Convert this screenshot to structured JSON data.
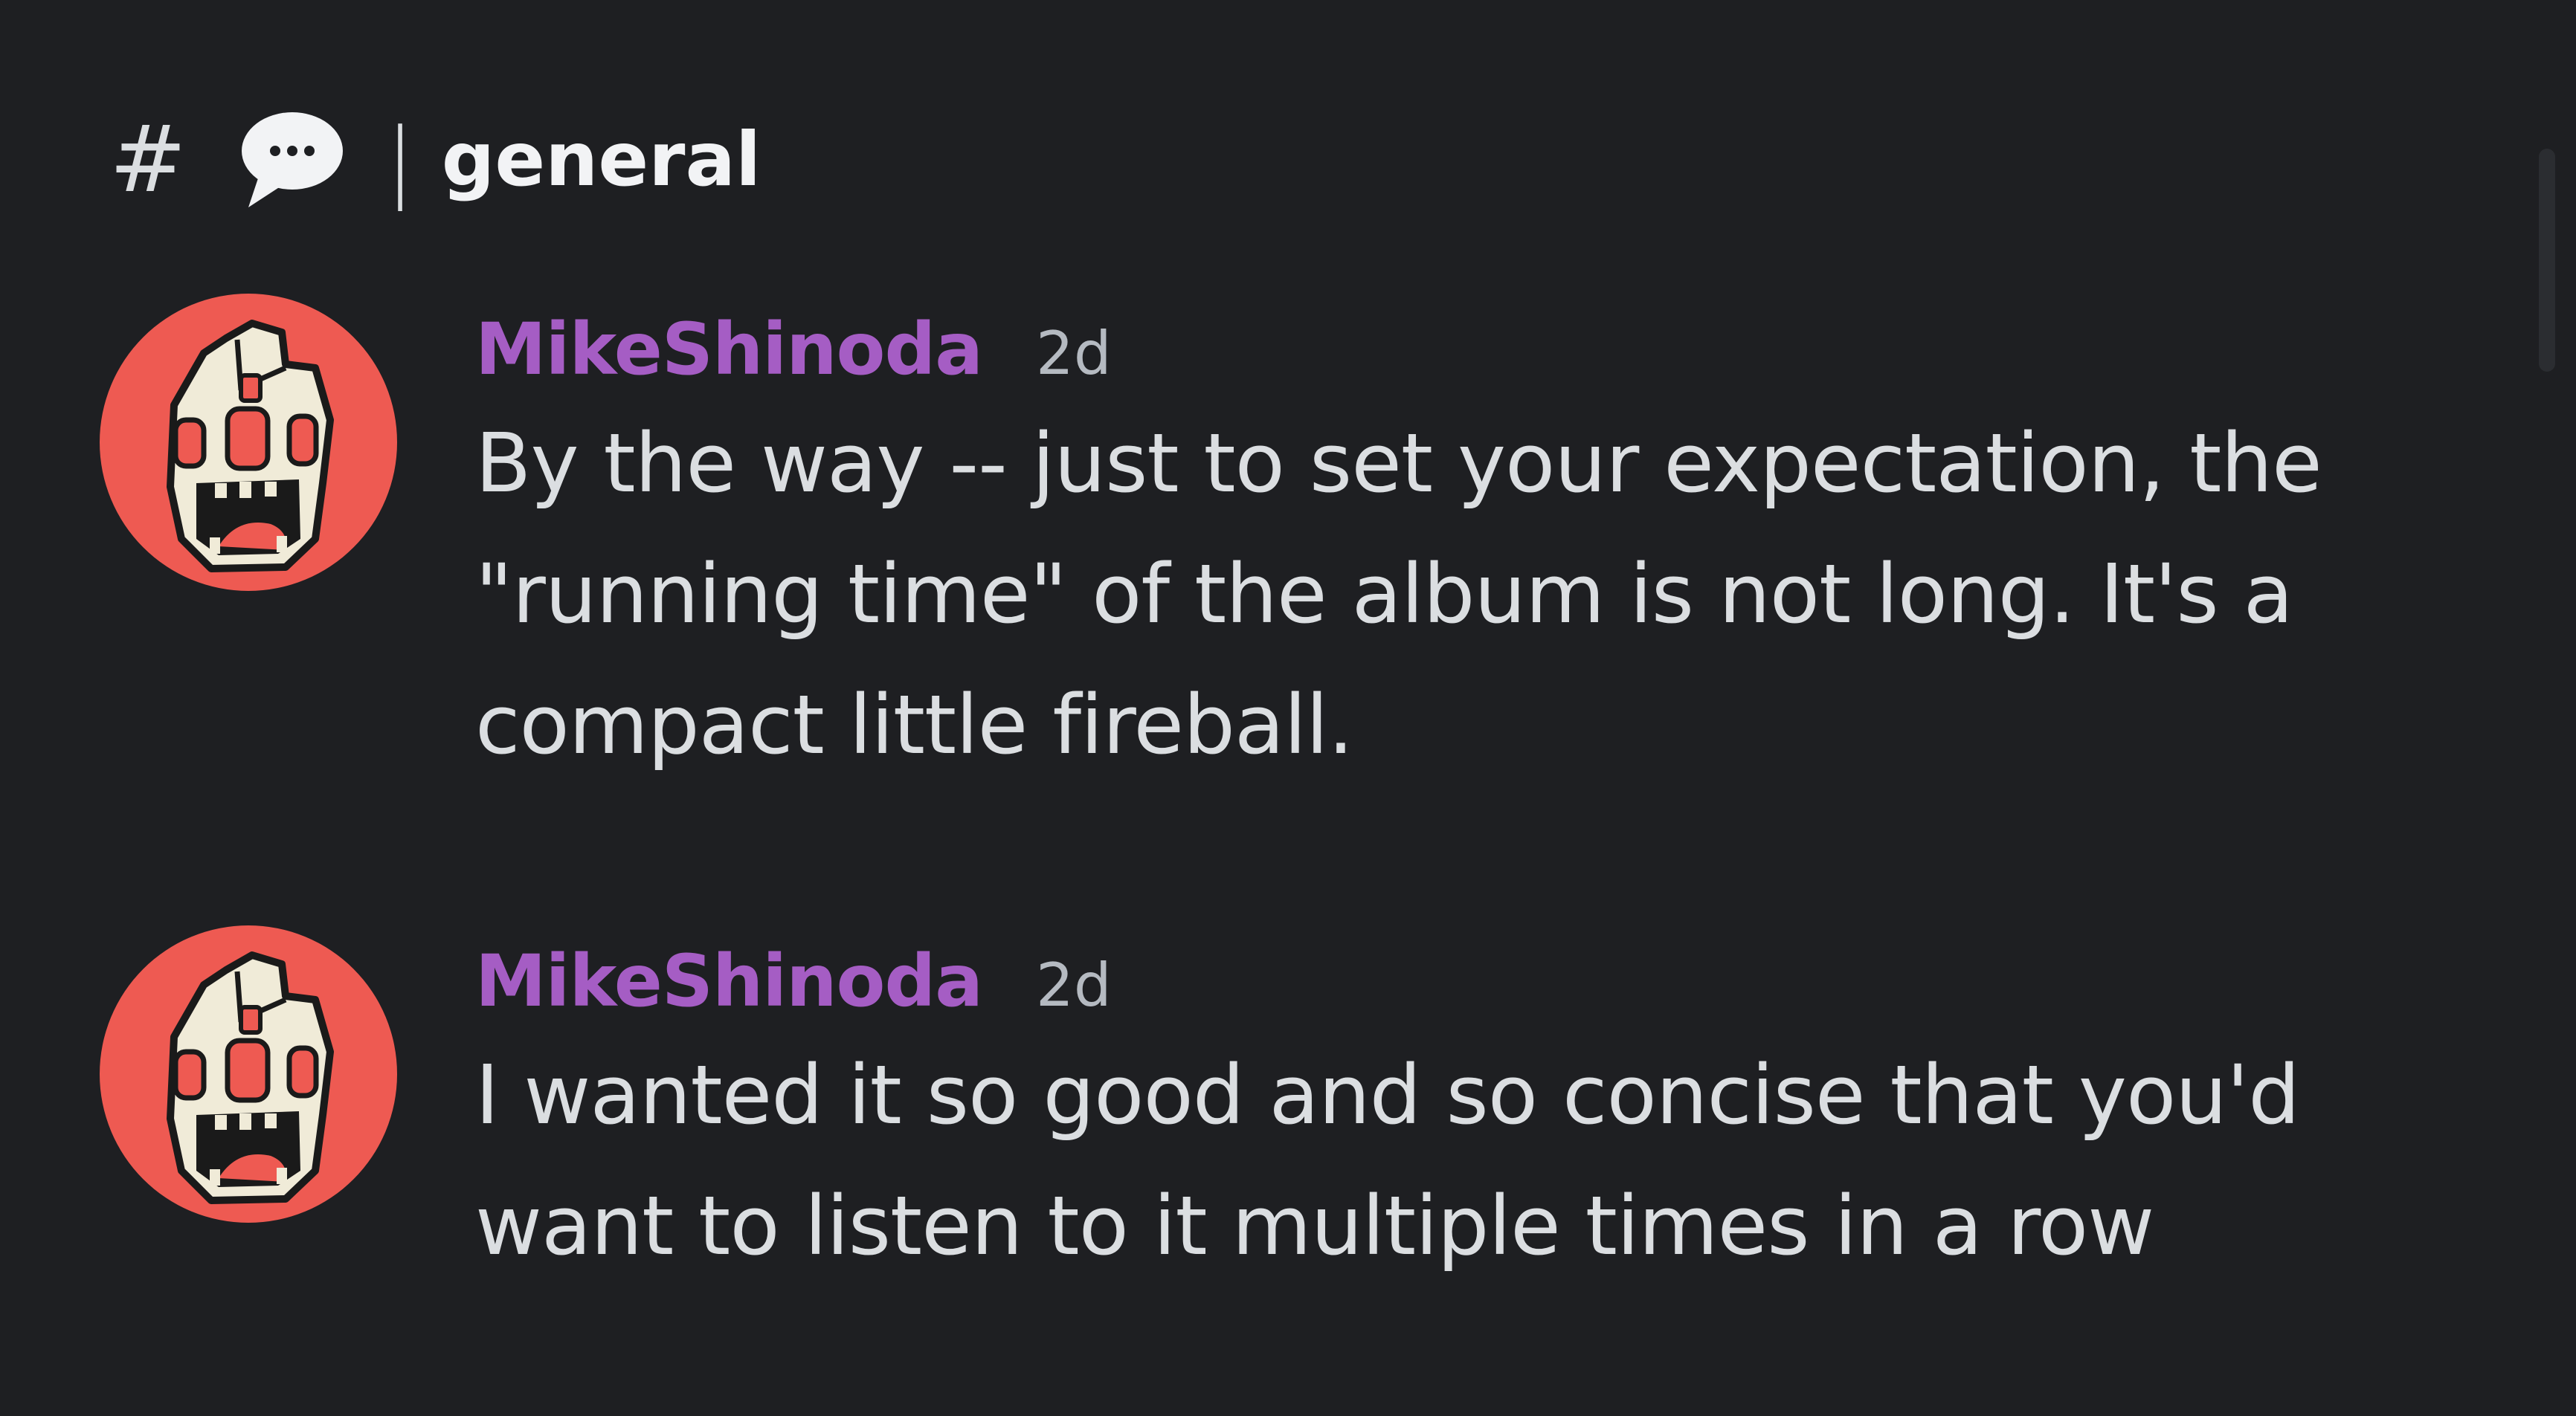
{
  "channel": {
    "hash_symbol": "#",
    "emoji_icon": "speech-bubble-icon",
    "separator": "|",
    "name": "general"
  },
  "colors": {
    "background": "#1e1f22",
    "username": "#a55dc4",
    "text": "#dbdee1",
    "timestamp": "#b5bac1",
    "avatar_bg": "#ee5a52"
  },
  "messages": [
    {
      "username": "MikeShinoda",
      "timestamp": "2d",
      "avatar_icon": "cartoon-monster-avatar-icon",
      "lines": [
        "By the way -- just to set your expectation, the",
        "\"running time\" of the album is not long. It's a",
        "compact little fireball."
      ]
    },
    {
      "username": "MikeShinoda",
      "timestamp": "2d",
      "avatar_icon": "cartoon-monster-avatar-icon",
      "lines": [
        "I wanted it so good and so concise that you'd",
        "want to listen to it multiple times in a row"
      ]
    }
  ]
}
